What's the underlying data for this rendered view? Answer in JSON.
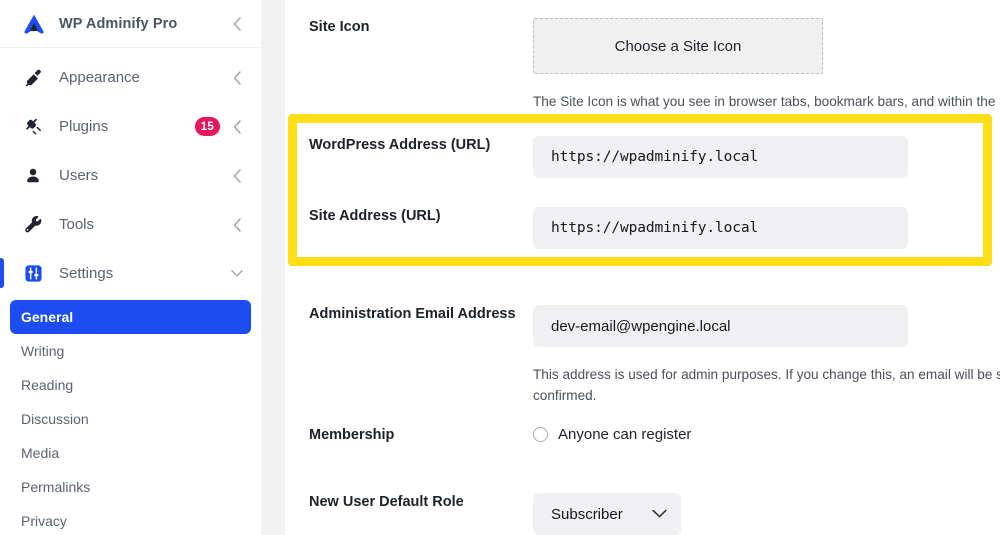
{
  "sidebar": {
    "brand": {
      "label": "WP Adminify Pro",
      "logo_icon": "adminify-logo-icon",
      "chevron_icon": "chevron-left-icon"
    },
    "items": [
      {
        "label": "Appearance",
        "icon": "paintbrush-icon",
        "chevron": "chevron-left-icon",
        "badge": null
      },
      {
        "label": "Plugins",
        "icon": "plug-icon",
        "chevron": "chevron-left-icon",
        "badge": "15"
      },
      {
        "label": "Users",
        "icon": "user-icon",
        "chevron": "chevron-left-icon",
        "badge": null
      },
      {
        "label": "Tools",
        "icon": "wrench-icon",
        "chevron": "chevron-left-icon",
        "badge": null
      },
      {
        "label": "Settings",
        "icon": "sliders-icon",
        "chevron": "chevron-down-icon",
        "badge": null
      }
    ],
    "submenu": [
      {
        "label": "General",
        "selected": true
      },
      {
        "label": "Writing",
        "selected": false
      },
      {
        "label": "Reading",
        "selected": false
      },
      {
        "label": "Discussion",
        "selected": false
      },
      {
        "label": "Media",
        "selected": false
      },
      {
        "label": "Permalinks",
        "selected": false
      },
      {
        "label": "Privacy",
        "selected": false
      }
    ]
  },
  "main": {
    "site_icon": {
      "label": "Site Icon",
      "button_label": "Choose a Site Icon",
      "help": "The Site Icon is what you see in browser tabs, bookmark bars, and within the"
    },
    "wordpress_address": {
      "label": "WordPress Address (URL)",
      "value": "https://wpadminify.local"
    },
    "site_address": {
      "label": "Site Address (URL)",
      "value": "https://wpadminify.local"
    },
    "admin_email": {
      "label": "Administration Email Address",
      "value": "dev-email@wpengine.local",
      "help": "This address is used for admin purposes. If you change this, an email will be s active until confirmed."
    },
    "membership": {
      "label": "Membership",
      "option_label": "Anyone can register",
      "checked": false
    },
    "default_role": {
      "label": "New User Default Role",
      "value": "Subscriber",
      "chevron_icon": "chevron-down-icon"
    }
  },
  "colors": {
    "accent_blue": "#1b4df0",
    "badge_pink": "#e5185f",
    "highlight_yellow": "#ffde17",
    "input_gray": "#f0f0f2"
  }
}
